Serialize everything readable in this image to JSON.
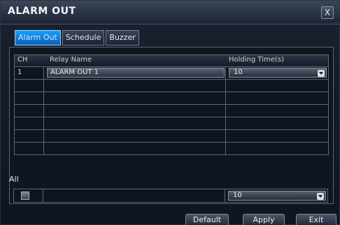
{
  "window": {
    "title": "ALARM OUT",
    "close_label": "X"
  },
  "tabs": [
    {
      "label": "Alarm Out",
      "active": true
    },
    {
      "label": "Schedule",
      "active": false
    },
    {
      "label": "Buzzer",
      "active": false
    }
  ],
  "table": {
    "columns": [
      "CH",
      "Relay Name",
      "Holding Time(s)"
    ],
    "rows": [
      {
        "ch": "1",
        "relay_name": "ALARM OUT 1",
        "holding_time": "10"
      }
    ]
  },
  "all": {
    "label": "All",
    "holding_time": "10"
  },
  "buttons": {
    "default": "Default",
    "apply": "Apply",
    "exit": "Exit"
  }
}
